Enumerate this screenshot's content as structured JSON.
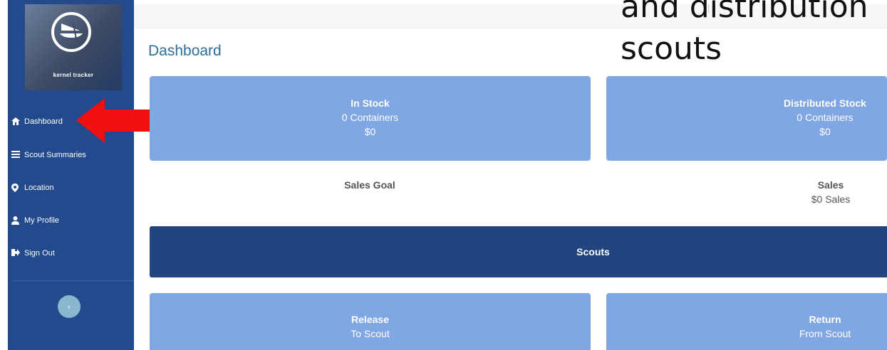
{
  "overlay": {
    "line1": "and distribution",
    "line2": "scouts"
  },
  "sidebar": {
    "brand": "kernel tracker",
    "items": [
      {
        "label": "Dashboard",
        "icon": "home-icon"
      },
      {
        "label": "Scout Summaries",
        "icon": "list-icon"
      },
      {
        "label": "Location",
        "icon": "map-marker-icon"
      },
      {
        "label": "My Profile",
        "icon": "user-icon"
      },
      {
        "label": "Sign Out",
        "icon": "sign-out-icon"
      }
    ],
    "collapse_glyph": "‹"
  },
  "page": {
    "title": "Dashboard"
  },
  "cards": {
    "in_stock": {
      "title": "In Stock",
      "line1": "0 Containers",
      "line2": "$0"
    },
    "distributed": {
      "title": "Distributed Stock",
      "line1": "0 Containers",
      "line2": "$0"
    },
    "release": {
      "title": "Release",
      "line1": "To Scout"
    },
    "return": {
      "title": "Return",
      "line1": "From Scout"
    }
  },
  "stats": {
    "sales_goal": {
      "title": "Sales Goal"
    },
    "sales": {
      "title": "Sales",
      "value": "$0 Sales"
    }
  },
  "scouts_bar": {
    "label": "Scouts"
  },
  "colors": {
    "sidebar": "#224a8c",
    "card": "#80a6e3",
    "scouts_bar": "#224580",
    "title": "#2d6f99",
    "arrow": "#f01010"
  }
}
